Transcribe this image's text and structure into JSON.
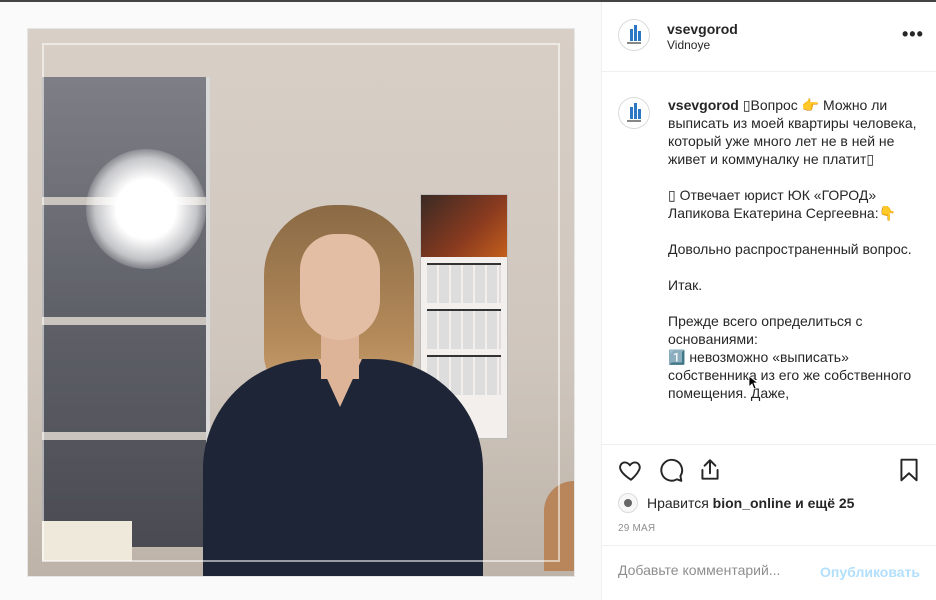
{
  "post": {
    "author": "vsevgorod",
    "location": "Vidnoye",
    "caption_username": "vsevgorod",
    "caption_text": "▯Вопрос 👉 Можно ли выписать из моей квартиры человека, который уже много лет не в ней не живет и коммуналку не платит▯\n\n▯ Отвечает юрист ЮК «ГОРОД» Лапикова Екатерина Сергеевна:👇\n\nДовольно распространенный вопрос.\n\nИтак.\n\nПрежде всего определиться с основаниями:\n1️⃣ невозможно «выписать» собственника из его же собственного помещения. Даже,"
  },
  "likes": {
    "prefix": "Нравится ",
    "user": "bion_online",
    "suffix": " и ещё 25"
  },
  "date": "29 мая",
  "comment": {
    "placeholder": "Добавьте комментарий...",
    "value": "",
    "publish_label": "Опубликовать"
  },
  "icons": {
    "more": "more-options-icon",
    "like": "heart-icon",
    "comment": "comment-icon",
    "share": "share-icon",
    "save": "bookmark-icon"
  },
  "colors": {
    "brand_blue": "#2b78c5",
    "publish_disabled": "#b2dffc",
    "secondary_text": "#8e8e8e"
  }
}
